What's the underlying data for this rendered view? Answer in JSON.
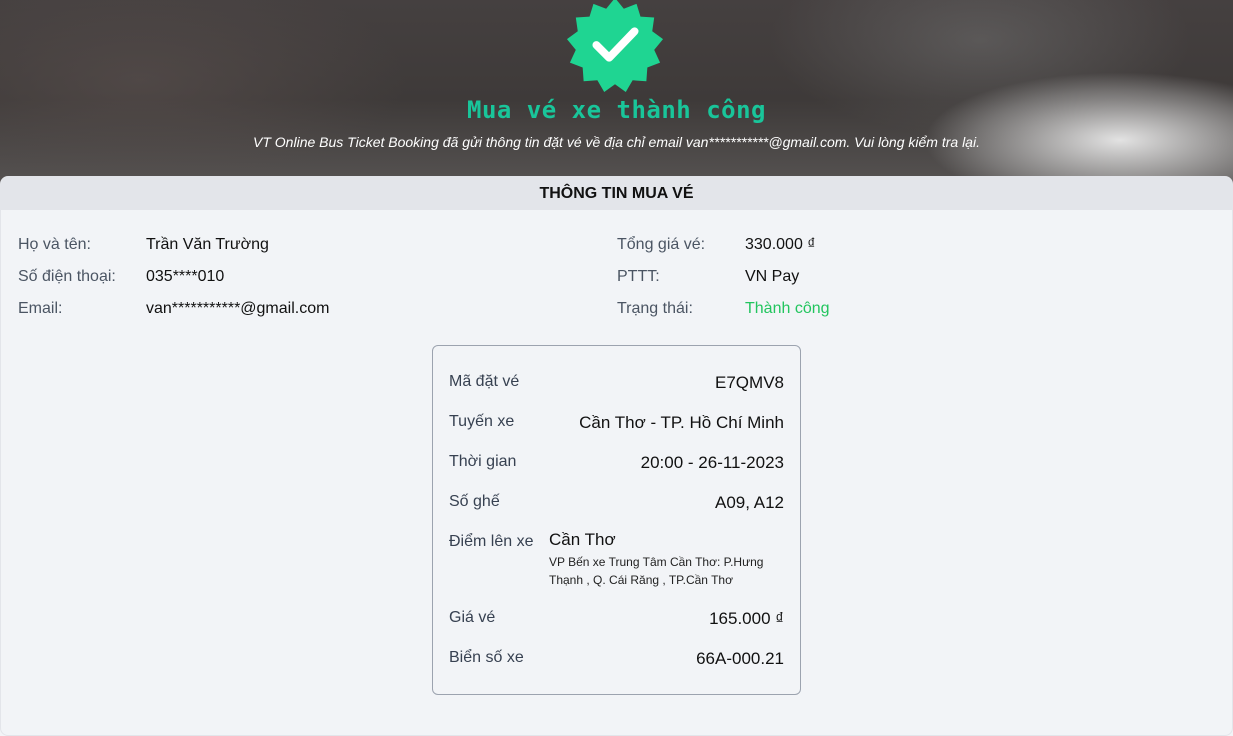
{
  "header": {
    "title": "Mua vé xe thành công",
    "subtitle": "VT Online Bus Ticket Booking đã gửi thông tin đặt vé về địa chỉ email van***********@gmail.com. Vui lòng kiểm tra lại.",
    "badge_icon": "check-badge-icon",
    "badge_color": "#19c59a"
  },
  "purchase_info": {
    "heading": "THÔNG TIN MUA VÉ",
    "left": [
      {
        "label": "Họ và tên:",
        "value": "Trần Văn Trường"
      },
      {
        "label": "Số điện thoại:",
        "value": "035****010"
      },
      {
        "label": "Email:",
        "value": "van***********@gmail.com"
      }
    ],
    "right": [
      {
        "label": "Tổng giá vé:",
        "value": "330.000 ₫"
      },
      {
        "label": "PTTT:",
        "value": "VN Pay"
      },
      {
        "label": "Trạng thái:",
        "value": "Thành công",
        "color": "#22c55e"
      }
    ]
  },
  "ticket": {
    "booking_code": {
      "label": "Mã đặt vé",
      "value": "E7QMV8"
    },
    "route": {
      "label": "Tuyến xe",
      "value": "Cần Thơ - TP. Hồ Chí Minh"
    },
    "time": {
      "label": "Thời gian",
      "value": "20:00 - 26-11-2023"
    },
    "seats": {
      "label": "Số ghế",
      "value": "A09, A12"
    },
    "pickup": {
      "label": "Điểm lên xe",
      "value": "Cần Thơ",
      "detail": "VP Bến xe Trung Tâm Cần Thơ: P.Hưng Thạnh , Q. Cái Răng , TP.Cần Thơ"
    },
    "price": {
      "label": "Giá vé",
      "value": "165.000 ₫"
    },
    "plate": {
      "label": "Biển số xe",
      "value": "66A-000.21"
    }
  }
}
